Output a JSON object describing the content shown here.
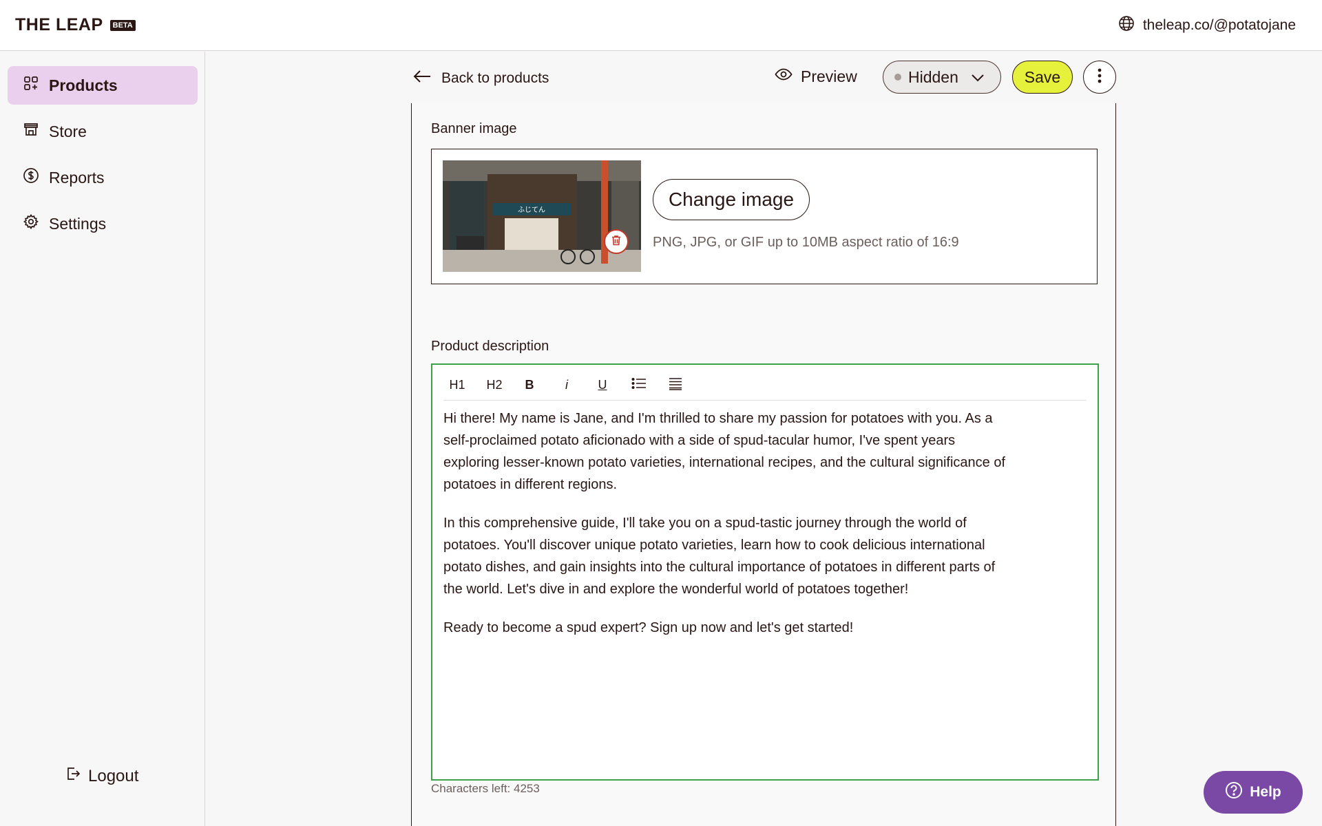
{
  "brand": {
    "name": "THE LEAP",
    "badge": "BETA"
  },
  "site_link": "theleap.co/@potatojane",
  "sidebar": {
    "items": [
      {
        "label": "Products",
        "icon": "grid-plus-icon",
        "active": true
      },
      {
        "label": "Store",
        "icon": "storefront-icon",
        "active": false
      },
      {
        "label": "Reports",
        "icon": "dollar-circle-icon",
        "active": false
      },
      {
        "label": "Settings",
        "icon": "gear-icon",
        "active": false
      }
    ],
    "logout_label": "Logout"
  },
  "header": {
    "back_label": "Back to products",
    "preview_label": "Preview",
    "visibility": {
      "selected": "Hidden"
    },
    "save_label": "Save"
  },
  "banner": {
    "label": "Banner image",
    "change_label": "Change image",
    "hint": "PNG, JPG, or GIF up to 10MB aspect ratio of 16:9",
    "image_sign_text": "ふじてん"
  },
  "description": {
    "label": "Product description",
    "toolbar": {
      "h1": "H1",
      "h2": "H2",
      "bold": "B",
      "italic": "i",
      "underline": "U"
    },
    "paragraphs": [
      "Hi there! My name is Jane, and I'm thrilled to share my passion for potatoes with you. As a self-proclaimed potato aficionado with a side of spud-tacular humor, I've spent years exploring lesser-known potato varieties, international recipes, and the cultural significance of potatoes in different regions.",
      "In this comprehensive guide, I'll take you on a spud-tastic journey through the world of potatoes. You'll discover unique potato varieties, learn how to cook delicious international potato dishes, and gain insights into the cultural importance of potatoes in different parts of the world. Let's dive in and explore the wonderful world of potatoes together!",
      "Ready to become a spud expert? Sign up now and let's get started!"
    ],
    "chars_left": "Characters left: 4253"
  },
  "help_label": "Help",
  "colors": {
    "accent_active": "#ead0ec",
    "save": "#e5f13a",
    "editor_border": "#3fa04a",
    "help": "#7a49a5"
  }
}
